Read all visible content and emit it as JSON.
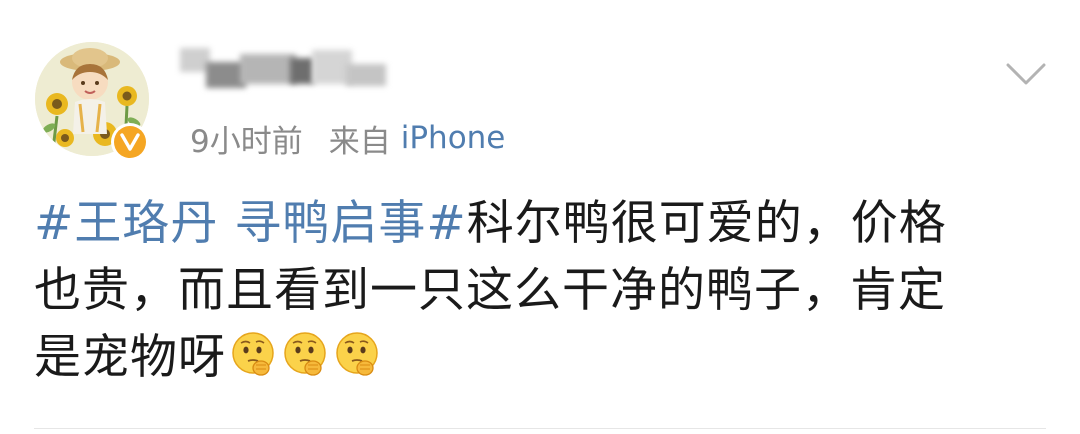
{
  "post": {
    "author": {
      "avatar_icon": "sunflower-girl-avatar",
      "verified_badge_icon": "verified-v-icon",
      "verified_badge_letter": "V",
      "badge_color": "#f5a623"
    },
    "meta": {
      "time": "9小时前",
      "from_label": "来自",
      "source": "iPhone"
    },
    "menu_icon": "chevron-down-icon",
    "content": {
      "hashtag": "#王珞丹 寻鸭启事#",
      "line1_rest": "科尔鸭很可爱的，价格",
      "line2": "也贵，而且看到一只这么干净的鸭子，肯定",
      "line3": "是宠物呀",
      "emojis": [
        "thinking-face-emoji",
        "thinking-face-emoji",
        "thinking-face-emoji"
      ]
    },
    "colors": {
      "link": "#507daf",
      "text": "#1a1a1a",
      "meta": "#8a8a8a"
    }
  }
}
